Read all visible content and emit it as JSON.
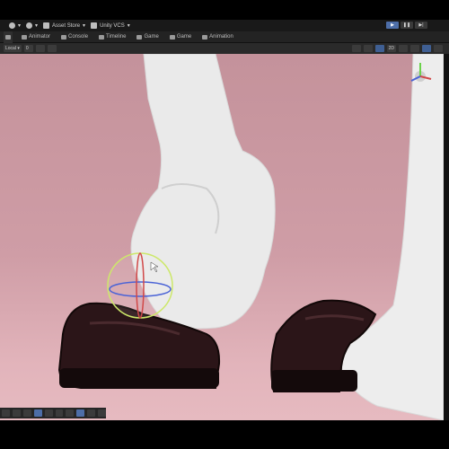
{
  "menubar": {
    "asset_store": "Asset Store",
    "vcs": "Unity VCS",
    "play_buttons": [
      "▶",
      "❚❚",
      "▶|"
    ]
  },
  "tabs": [
    {
      "label": "Animator"
    },
    {
      "label": "Console"
    },
    {
      "label": "Timeline"
    },
    {
      "label": "Game"
    },
    {
      "label": "Game"
    },
    {
      "label": "Animation"
    }
  ],
  "scene_toolbar": {
    "pivot": "Local",
    "snap_value": "0",
    "mode_2d": "2D"
  },
  "colors": {
    "accent": "#4d6ea8",
    "background": "#c89aa2",
    "panel": "#232323"
  }
}
